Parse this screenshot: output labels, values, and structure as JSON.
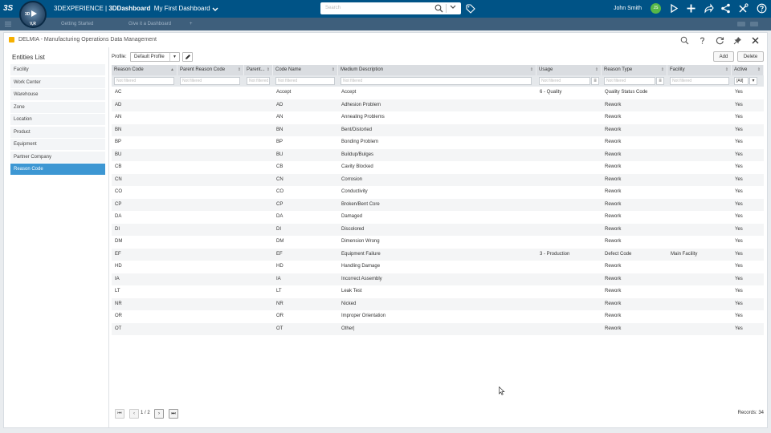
{
  "topbar": {
    "ds_logo": "3S",
    "compass_n": "3D",
    "compass_version": "V,R",
    "brand_prefix": "3DEXPERIENCE",
    "brand_sep": " | ",
    "brand_app": "3DDashboard",
    "dashboard_name": "My First Dashboard",
    "search_placeholder": "Search",
    "user_name": "John Smith",
    "user_initials": "JS"
  },
  "tabs": {
    "tab1": "Getting Started",
    "tab2": "Give it a Dashboard"
  },
  "window": {
    "title": "DELMIA - Manufacturing Operations Data Management"
  },
  "entities": {
    "heading": "Entities List",
    "items": [
      {
        "label": "Facility"
      },
      {
        "label": "Work Center"
      },
      {
        "label": "Warehouse"
      },
      {
        "label": "Zone"
      },
      {
        "label": "Location"
      },
      {
        "label": "Product"
      },
      {
        "label": "Equipment"
      },
      {
        "label": "Partner Company"
      },
      {
        "label": "Reason Code"
      }
    ],
    "selected": "Reason Code"
  },
  "toolbar": {
    "profile_label": "Profile:",
    "profile_value": "Default Profile",
    "add_label": "Add",
    "delete_label": "Delete"
  },
  "grid": {
    "columns": [
      "Reason Code",
      "Parent Reason Code",
      "Parent...",
      "Code Name",
      "Medium Description",
      "Usage",
      "Reason Type",
      "Facility",
      "Active"
    ],
    "filter_placeholder": "Not filtered",
    "active_filter": "[All]",
    "rows": [
      [
        "AC",
        "",
        "",
        "Accept",
        "Accept",
        "6 - Quality",
        "Quality Status Code",
        "",
        "Yes"
      ],
      [
        "AD",
        "",
        "",
        "AD",
        "Adhesion Problem",
        "",
        "Rework",
        "",
        "Yes"
      ],
      [
        "AN",
        "",
        "",
        "AN",
        "Annealing Problems",
        "",
        "Rework",
        "",
        "Yes"
      ],
      [
        "BN",
        "",
        "",
        "BN",
        "Bent/Distorted",
        "",
        "Rework",
        "",
        "Yes"
      ],
      [
        "BP",
        "",
        "",
        "BP",
        "Bonding Problem",
        "",
        "Rework",
        "",
        "Yes"
      ],
      [
        "BU",
        "",
        "",
        "BU",
        "Buildup/Bulges",
        "",
        "Rework",
        "",
        "Yes"
      ],
      [
        "CB",
        "",
        "",
        "CB",
        "Cavity Blocked",
        "",
        "Rework",
        "",
        "Yes"
      ],
      [
        "CN",
        "",
        "",
        "CN",
        "Corrosion",
        "",
        "Rework",
        "",
        "Yes"
      ],
      [
        "CO",
        "",
        "",
        "CO",
        "Conductivity",
        "",
        "Rework",
        "",
        "Yes"
      ],
      [
        "CP",
        "",
        "",
        "CP",
        "Broken/Bent Core",
        "",
        "Rework",
        "",
        "Yes"
      ],
      [
        "DA",
        "",
        "",
        "DA",
        "Damaged",
        "",
        "Rework",
        "",
        "Yes"
      ],
      [
        "DI",
        "",
        "",
        "DI",
        "Discolored",
        "",
        "Rework",
        "",
        "Yes"
      ],
      [
        "DM",
        "",
        "",
        "DM",
        "Dimension Wrong",
        "",
        "Rework",
        "",
        "Yes"
      ],
      [
        "EF",
        "",
        "",
        "EF",
        "Equipment Failure",
        "3 - Production",
        "Defect Code",
        "Main Facility",
        "Yes"
      ],
      [
        "HD",
        "",
        "",
        "HD",
        "Handling Damage",
        "",
        "Rework",
        "",
        "Yes"
      ],
      [
        "IA",
        "",
        "",
        "IA",
        "Incorrect Assembly",
        "",
        "Rework",
        "",
        "Yes"
      ],
      [
        "LT",
        "",
        "",
        "LT",
        "Leak Test",
        "",
        "Rework",
        "",
        "Yes"
      ],
      [
        "NR",
        "",
        "",
        "NR",
        "Nicked",
        "",
        "Rework",
        "",
        "Yes"
      ],
      [
        "OR",
        "",
        "",
        "OR",
        "Improper Orientation",
        "",
        "Rework",
        "",
        "Yes"
      ],
      [
        "OT",
        "",
        "",
        "OT",
        "Other|",
        "",
        "Rework",
        "",
        "Yes"
      ]
    ]
  },
  "footer": {
    "page_info": "1 / 2",
    "records": "Records: 34"
  },
  "colors": {
    "topbar": "#005386",
    "selected_entity": "#3d97d3",
    "avatar": "#57b847"
  }
}
